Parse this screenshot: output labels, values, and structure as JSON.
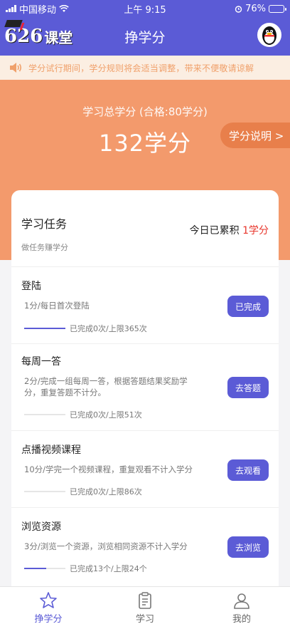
{
  "status": {
    "carrier": "中国移动",
    "time": "上午 9:15",
    "battery": "76%",
    "battery_level": 0.76
  },
  "nav": {
    "logo_text": "626课堂",
    "title": "挣学分"
  },
  "notice": {
    "text": "学分试行期间，学分规则将会适当调整，带来不便敬请谅解"
  },
  "summary": {
    "label": "学习总学分 (合格:80学分)",
    "value": "132学分",
    "explain_label": "学分说明 >"
  },
  "tasks_header": {
    "title": "学习任务",
    "subtitle": "做任务赚学分",
    "today_prefix": "今日已累积 ",
    "today_value": "1学分"
  },
  "tasks": [
    {
      "name": "登陆",
      "desc": "1分/每日首次登陆",
      "progress_text": "已完成0次/上限365次",
      "progress": 1.0,
      "button": "已完成"
    },
    {
      "name": "每周一答",
      "desc": "2分/完成一组每周一答，根据答题结果奖励学分，重复答题不计分。",
      "progress_text": "已完成0次/上限51次",
      "progress": 0,
      "button": "去答题"
    },
    {
      "name": "点播视频课程",
      "desc": "10分/学完一个视频课程，重复观看不计入学分",
      "progress_text": "已完成0次/上限86次",
      "progress": 0,
      "button": "去观看"
    },
    {
      "name": "浏览资源",
      "desc": "3分/浏览一个资源，浏览相同资源不计入学分",
      "progress_text": "已完成13个/上限24个",
      "progress": 0.54,
      "button": "去浏览"
    }
  ],
  "tabs": [
    {
      "label": "挣学分",
      "icon": "star-icon",
      "active": true
    },
    {
      "label": "学习",
      "icon": "clipboard-icon",
      "active": false
    },
    {
      "label": "我的",
      "icon": "user-icon",
      "active": false
    }
  ],
  "colors": {
    "primary": "#5b5bd6",
    "hero": "#f39a6c",
    "accent_red": "#e8352b"
  }
}
